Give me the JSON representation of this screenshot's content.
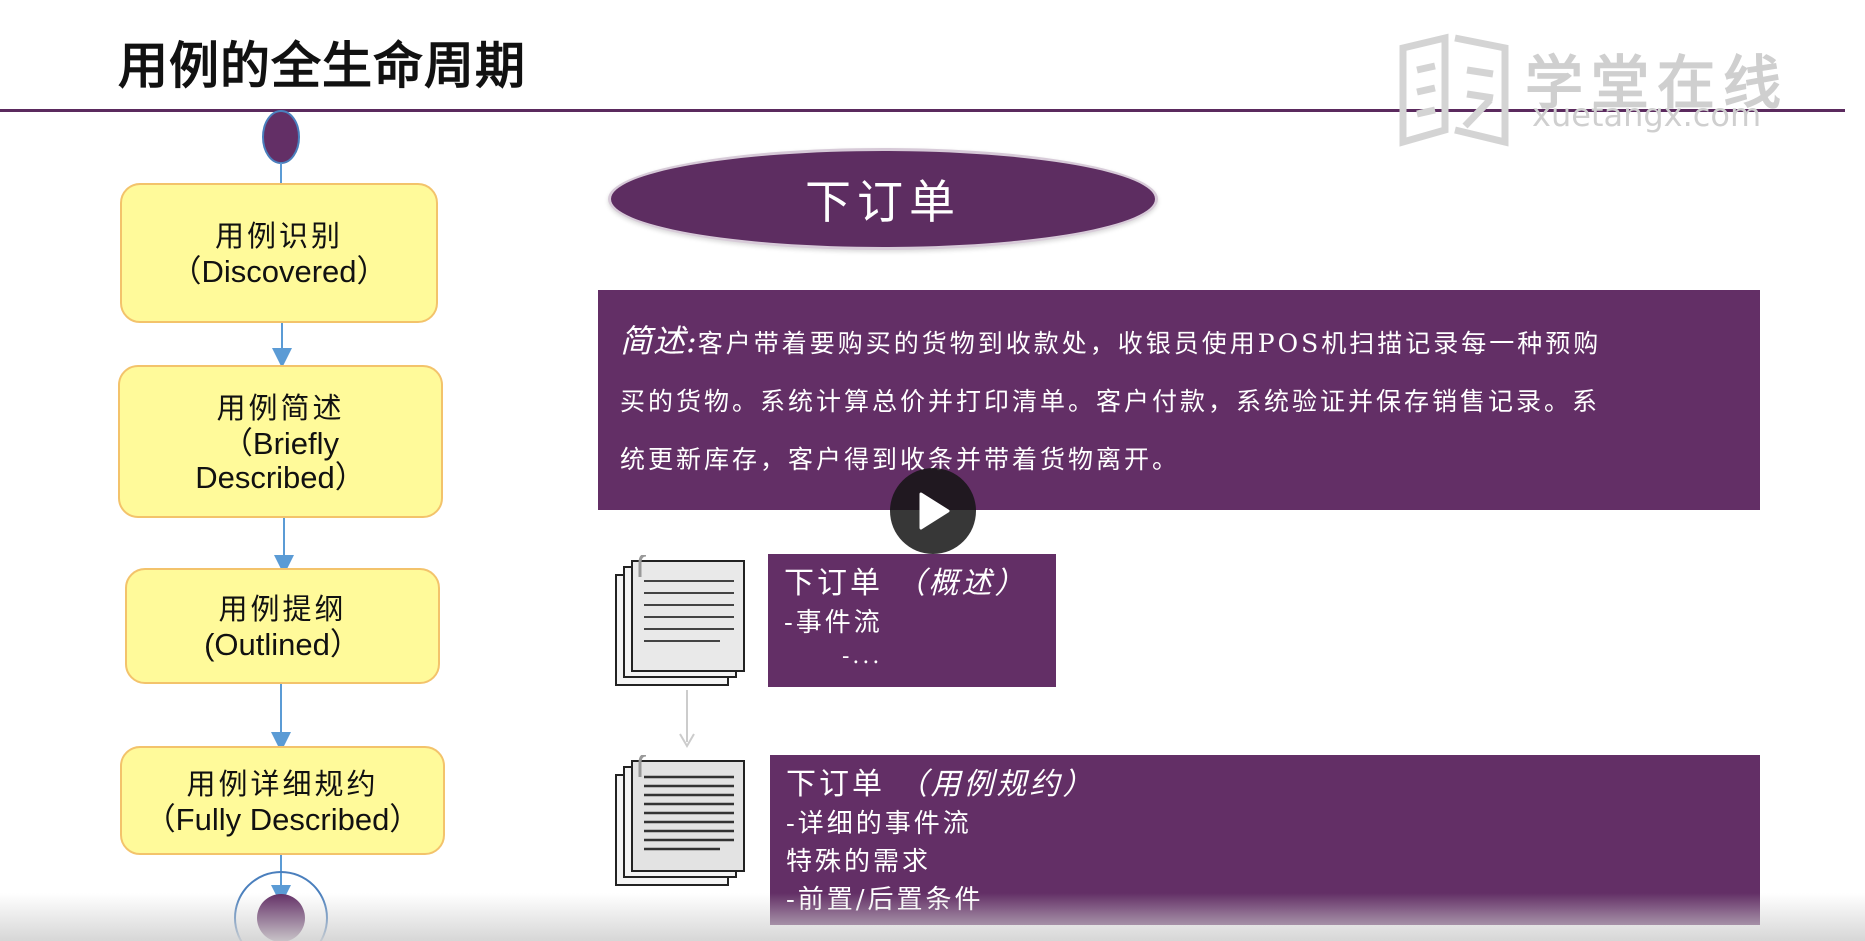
{
  "slide": {
    "title": "用例的全生命周期"
  },
  "watermark": {
    "cn": "学堂在线",
    "en": "xuetangx.com"
  },
  "lifecycle": [
    {
      "cn": "用例识别",
      "en": "（Discovered）"
    },
    {
      "cn": "用例简述",
      "en": "（Briefly",
      "en2": "Described）"
    },
    {
      "cn": "用例提纲",
      "en": "(Outlined）"
    },
    {
      "cn": "用例详细规约",
      "en": "（Fully Described）"
    }
  ],
  "usecase": {
    "name": "下订单",
    "summary_label": "简述:",
    "summary_line1": "客户带着要购买的货物到收款处，收银员使用POS机扫描记录每一种预购",
    "summary_line2": "买的货物。系统计算总价并打印清单。客户付款，系统验证并保存销售记录。系",
    "summary_line3": "统更新库存，客户得到收条并带着货物离开。"
  },
  "outline_doc": {
    "title": "下订单",
    "subtitle": "（概述）",
    "line1": "-事件流",
    "line2": "-..."
  },
  "spec_doc": {
    "title": "下订单",
    "subtitle": "（用例规约）",
    "line1": "-详细的事件流",
    "line2": "特殊的需求",
    "line3": "-前置/后置条件"
  },
  "colors": {
    "purple": "#632f66",
    "stage_fill": "#fffa9a",
    "stage_border": "#f3c36b",
    "arrow": "#5b9bd5"
  },
  "controls": {
    "play_icon": "play-icon"
  }
}
